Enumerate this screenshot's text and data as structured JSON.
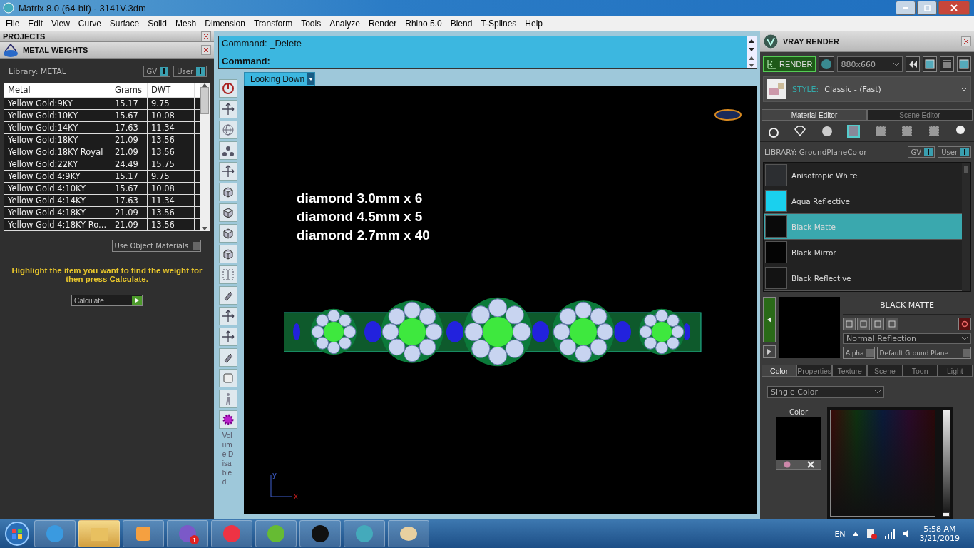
{
  "window": {
    "title": "Matrix 8.0 (64-bit) - 3141V.3dm"
  },
  "menu": [
    "File",
    "Edit",
    "View",
    "Curve",
    "Surface",
    "Solid",
    "Mesh",
    "Dimension",
    "Transform",
    "Tools",
    "Analyze",
    "Render",
    "Rhino 5.0",
    "Blend",
    "T-Splines",
    "Help"
  ],
  "left_panel": {
    "projects_title": "PROJECTS",
    "title": "METAL WEIGHTS",
    "library_label": "Library: METAL",
    "toggles": [
      {
        "label": "GV",
        "on": true
      },
      {
        "label": "User",
        "on": true
      }
    ],
    "table": {
      "columns": [
        "Metal",
        "Grams",
        "DWT"
      ],
      "rows": [
        [
          "Yellow Gold:9KY",
          "15.17",
          "9.75"
        ],
        [
          "Yellow Gold:10KY",
          "15.67",
          "10.08"
        ],
        [
          "Yellow Gold:14KY",
          "17.63",
          "11.34"
        ],
        [
          "Yellow Gold:18KY",
          "21.09",
          "13.56"
        ],
        [
          "Yellow Gold:18KY Royal",
          "21.09",
          "13.56"
        ],
        [
          "Yellow Gold:22KY",
          "24.49",
          "15.75"
        ],
        [
          "Yellow Gold 4:9KY",
          "15.17",
          "9.75"
        ],
        [
          "Yellow Gold 4:10KY",
          "15.67",
          "10.08"
        ],
        [
          "Yellow Gold 4:14KY",
          "17.63",
          "11.34"
        ],
        [
          "Yellow Gold 4:18KY",
          "21.09",
          "13.56"
        ],
        [
          "Yellow Gold 4:18KY Ro...",
          "21.09",
          "13.56"
        ]
      ]
    },
    "use_object_materials": {
      "label": "Use Object Materials",
      "checked": false
    },
    "hint": "Highlight the item you want to find the weight for then press Calculate.",
    "calculate_button": "Calculate"
  },
  "command": {
    "history": "Command:  _Delete",
    "prompt": "Command:"
  },
  "side_toolbar": {
    "status": "Volume Disabled"
  },
  "viewport": {
    "view_menu": "Looking Down",
    "annotations": [
      "diamond 3.0mm x 6",
      "diamond 4.5mm x 5",
      "diamond 2.7mm x 40"
    ],
    "axis_labels": [
      "y",
      "x"
    ]
  },
  "right_panel": {
    "title": "VRAY RENDER",
    "render_button": "RENDER",
    "resolution": "880x660",
    "style_label": "STYLE:",
    "style_value": "Classic - (Fast)",
    "tabs": [
      {
        "label": "Material Editor",
        "selected": true
      },
      {
        "label": "Scene Editor",
        "selected": false
      }
    ],
    "library_label": "LIBRARY: GroundPlaneColor",
    "toggles": [
      {
        "label": "GV",
        "on": true
      },
      {
        "label": "User",
        "on": true
      }
    ],
    "materials": [
      {
        "name": "Anisotropic White",
        "color": "#2c2e31",
        "selected": false
      },
      {
        "name": "Aqua Reflective",
        "color": "#1ad0ee",
        "selected": false
      },
      {
        "name": "Black Matte",
        "color": "#0a0a0a",
        "selected": true
      },
      {
        "name": "Black Mirror",
        "color": "#040404",
        "selected": false
      },
      {
        "name": "Black Reflective",
        "color": "#131313",
        "selected": false
      }
    ],
    "material_name": "BLACK MATTE",
    "reflection": "Normal Reflection",
    "options": [
      {
        "label": "Alpha",
        "checked": false
      },
      {
        "label": "Default Ground Plane",
        "checked": false
      }
    ],
    "property_tabs": [
      {
        "label": "Color",
        "selected": true
      },
      {
        "label": "Properties",
        "selected": false
      },
      {
        "label": "Texture",
        "selected": false
      },
      {
        "label": "Scene",
        "selected": false
      },
      {
        "label": "Toon",
        "selected": false
      },
      {
        "label": "Light",
        "selected": false
      }
    ],
    "color_mode": "Single Color",
    "swatch_label": "Color",
    "brightness": {
      "level": 0
    }
  },
  "taskbar": {
    "badge": "1",
    "language": "EN",
    "time": "5:58 AM",
    "date": "3/21/2019"
  }
}
